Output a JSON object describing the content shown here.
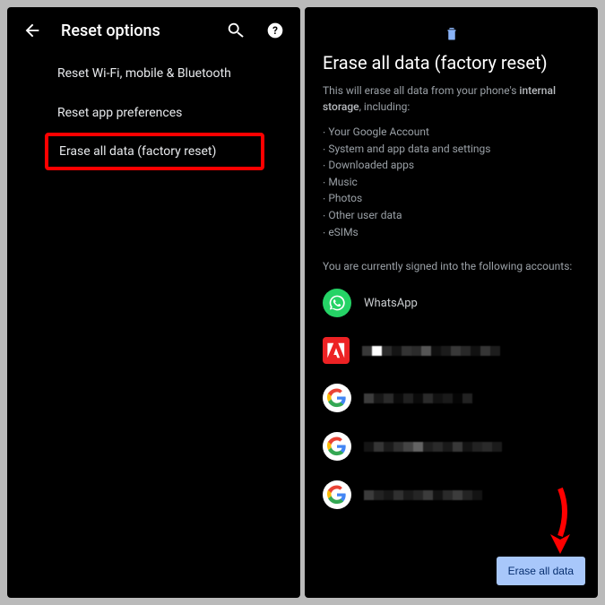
{
  "left": {
    "title": "Reset options",
    "items": [
      "Reset Wi-Fi, mobile & Bluetooth",
      "Reset app preferences",
      "Erase all data (factory reset)"
    ]
  },
  "right": {
    "title": "Erase all data (factory reset)",
    "desc_prefix": "This will erase all data from your phone's ",
    "desc_bold": "internal storage",
    "desc_suffix": ", including:",
    "bullets": [
      "Your Google Account",
      "System and app data and settings",
      "Downloaded apps",
      "Music",
      "Photos",
      "Other user data",
      "eSIMs"
    ],
    "signedInText": "You are currently signed into the following accounts:",
    "accounts": [
      {
        "name": "WhatsApp",
        "type": "whatsapp"
      },
      {
        "name": "",
        "type": "adobe"
      },
      {
        "name": "",
        "type": "google"
      },
      {
        "name": "",
        "type": "google"
      },
      {
        "name": "",
        "type": "google"
      }
    ],
    "button": "Erase all data"
  }
}
